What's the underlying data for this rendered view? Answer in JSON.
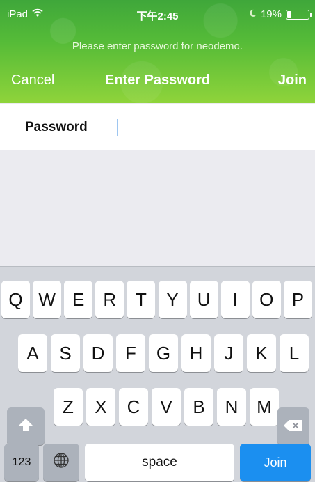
{
  "status_bar": {
    "device": "iPad",
    "time": "下午2:45",
    "battery": "19%",
    "battery_level": 0.19
  },
  "prompt": "Please enter password for neodemo.",
  "navbar": {
    "cancel": "Cancel",
    "title": "Enter Password",
    "join": "Join"
  },
  "form": {
    "password_label": "Password",
    "password_value": ""
  },
  "keyboard": {
    "row1": [
      "Q",
      "W",
      "E",
      "R",
      "T",
      "Y",
      "U",
      "I",
      "O",
      "P"
    ],
    "row2": [
      "A",
      "S",
      "D",
      "F",
      "G",
      "H",
      "J",
      "K",
      "L"
    ],
    "row3": [
      "Z",
      "X",
      "C",
      "V",
      "B",
      "N",
      "M"
    ],
    "numbers_key": "123",
    "space_key": "space",
    "return_key": "Join",
    "icons": [
      "shift-icon",
      "backspace-icon",
      "globe-icon"
    ]
  },
  "colors": {
    "header_green": "#55bb38",
    "return_blue": "#1b8ff0",
    "keyboard_bg": "#d2d5db"
  }
}
